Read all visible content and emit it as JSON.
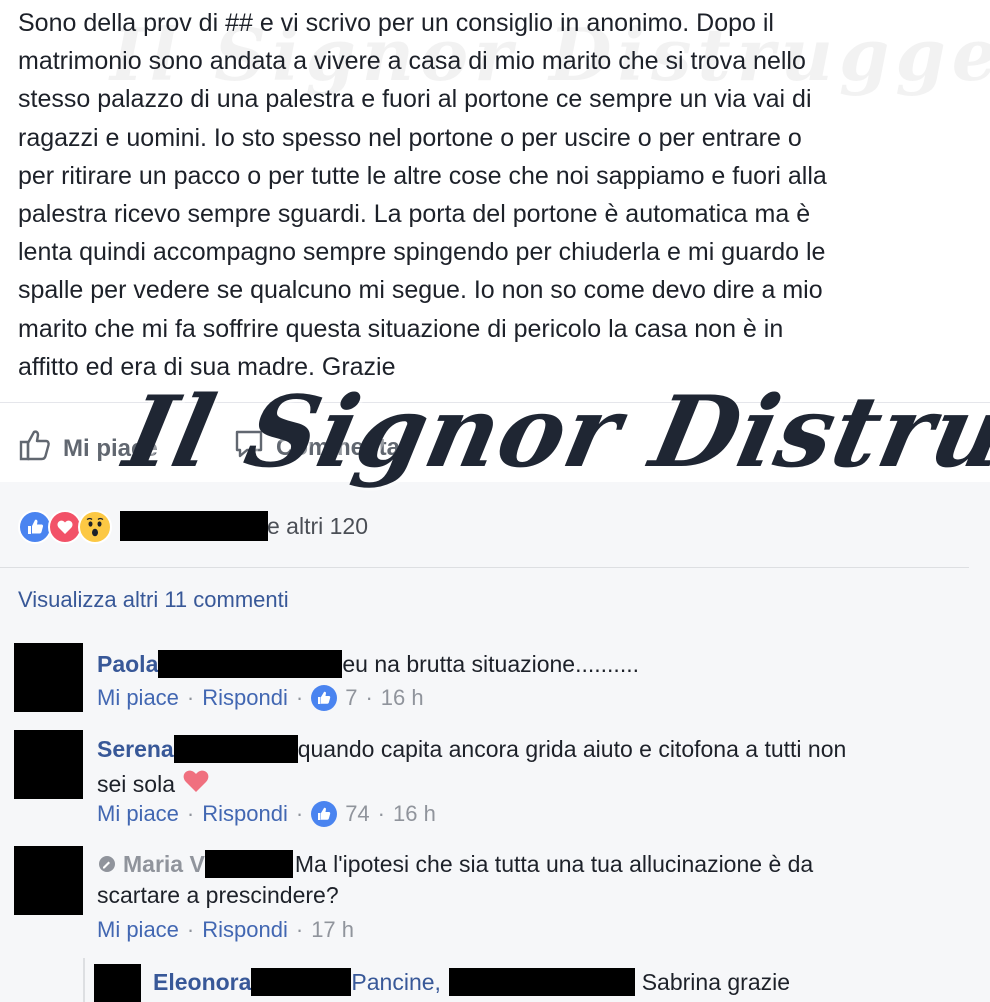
{
  "post": {
    "lines": [
      "Sono della prov di ## e vi scrivo per un consiglio in anonimo. Dopo il",
      "matrimonio sono andata a vivere a casa di mio marito che si trova nello",
      "stesso palazzo di una palestra e fuori al portone ce sempre un via vai di",
      "ragazzi e uomini. Io sto spesso nel portone o per uscire o per entrare o",
      "per ritirare un pacco o per tutte le altre cose che noi sappiamo e fuori alla",
      "palestra ricevo sempre sguardi. La porta del portone è automatica ma è",
      "lenta quindi accompagno sempre spingendo per chiuderla e mi guardo le",
      "spalle per vedere se qualcuno mi segue. Io non so come devo dire a mio",
      "marito che mi fa soffrire questa situazione di pericolo la casa non è in",
      "affitto ed era di sua madre. Grazie"
    ]
  },
  "actions": {
    "like_label": "Mi piace",
    "comment_label": "Commenta"
  },
  "reactions": {
    "icons": [
      "like-reaction-icon",
      "love-reaction-icon",
      "wow-reaction-icon"
    ],
    "others_text": "e altri 120"
  },
  "more_comments_label": "Visualizza altri 11 commenti",
  "comments": [
    {
      "name": "Paola",
      "text_line1": "eu na brutta situazione..........",
      "text_line2": "",
      "like": "Mi piace",
      "reply": "Rispondi",
      "likes": "7",
      "time": "16 h"
    },
    {
      "name": "Serena",
      "text_line1": "quando capita ancora grida aiuto e citofona a tutti non",
      "text_line2": "sei sola",
      "like": "Mi piace",
      "reply": "Rispondi",
      "likes": "74",
      "time": "16 h"
    },
    {
      "name": "Maria V",
      "text_line1": "Ma l'ipotesi che sia tutta una tua allucinazione è da",
      "text_line2": "scartare a prescindere?",
      "like": "Mi piace",
      "reply": "Rispondi",
      "time": "17 h"
    }
  ],
  "reply": {
    "name": "Eleonora",
    "tag": "Pancine,",
    "text": "Sabrina grazie"
  },
  "watermark": "Il Signor Distruggere",
  "colors": {
    "link_blue": "#385898",
    "meta_gray": "#90949c",
    "like_blue": "#4a84f0",
    "love_red": "#f25268",
    "wow_yellow": "#fcc844",
    "section_bg": "#f6f7f9"
  }
}
